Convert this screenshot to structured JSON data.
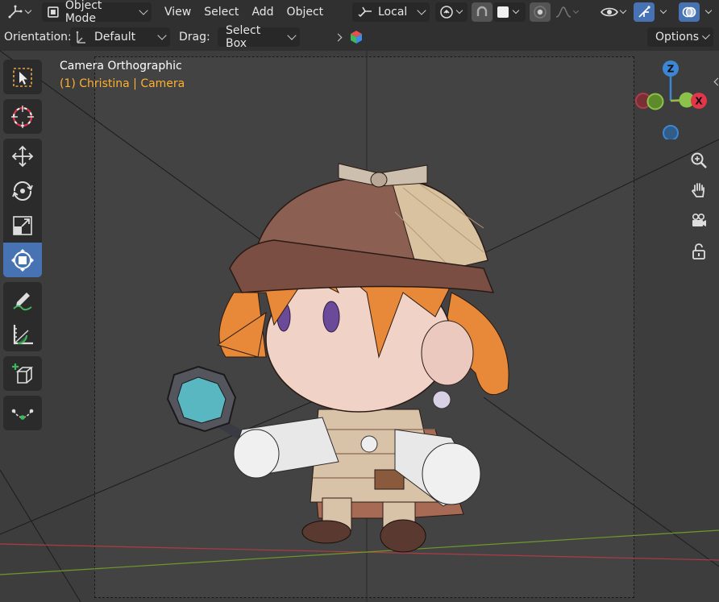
{
  "header": {
    "editor_type_icon": "transform-gizmo-icon",
    "mode": {
      "label": "Object Mode",
      "icon": "object-mode-icon"
    },
    "menus": [
      "View",
      "Select",
      "Add",
      "Object"
    ],
    "transform_orientation": {
      "label": "Local",
      "icon": "local-axes-icon"
    },
    "pivot_icon": "link-icon",
    "snap_icon": "magnet-icon",
    "proportional_icon": "proportional-edit-icon",
    "falloff_icon": "falloff-curve-icon",
    "visibility_icon": "eye-icon",
    "gizmo_icon": "gizmo-icon",
    "overlay_icon": "overlay-icon"
  },
  "tool_settings": {
    "orientation_label": "Orientation:",
    "orientation_value": "Default",
    "drag_label": "Drag:",
    "drag_value": "Select Box",
    "options_label": "Options"
  },
  "viewport": {
    "title": "Camera Orthographic",
    "subtitle": "(1) Christina | Camera",
    "gizmo_axes": {
      "z": "Z",
      "x": "X"
    }
  },
  "toolbar": {
    "tools": [
      {
        "name": "select-box",
        "icon": "select-box-icon",
        "active": false
      },
      {
        "name": "cursor",
        "icon": "cursor-icon",
        "active": false
      },
      {
        "name": "move",
        "icon": "move-icon",
        "active": false
      },
      {
        "name": "rotate",
        "icon": "rotate-icon",
        "active": false
      },
      {
        "name": "scale",
        "icon": "scale-icon",
        "active": false
      },
      {
        "name": "transform",
        "icon": "transform-icon",
        "active": true
      },
      {
        "name": "annotate",
        "icon": "annotate-icon",
        "active": false
      },
      {
        "name": "measure",
        "icon": "measure-icon",
        "active": false
      },
      {
        "name": "add-cube",
        "icon": "add-cube-icon",
        "active": false
      },
      {
        "name": "extrude",
        "icon": "extrude-icon",
        "active": false
      }
    ]
  },
  "navigation": [
    "zoom-icon",
    "hand-pan-icon",
    "camera-icon",
    "lock-icon"
  ],
  "colors": {
    "accent": "#4772b3",
    "header_bg": "#303030",
    "viewport_bg": "#3d3d3d",
    "subtitle": "#ffb02e",
    "axis_x": "#e2364a",
    "axis_y": "#8bc34a",
    "axis_z": "#3d86d6"
  }
}
